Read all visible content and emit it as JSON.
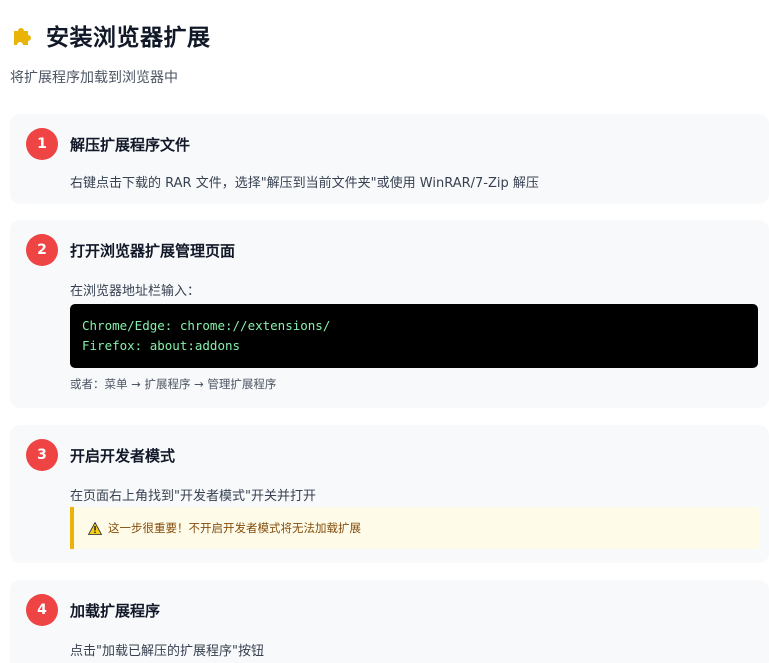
{
  "header": {
    "icon": "puzzle-piece-icon",
    "title": "安装浏览器扩展",
    "subtitle": "将扩展程序加载到浏览器中"
  },
  "colors": {
    "badge": "#ef4444",
    "warning_border": "#eab308",
    "warning_bg": "#fefce8",
    "code_bg": "#000000",
    "code_text": "#86efac",
    "card_bg": "#f8f9fb"
  },
  "steps": [
    {
      "number": "1",
      "title": "解压扩展程序文件",
      "description": "右键点击下载的 RAR 文件，选择\"解压到当前文件夹\"或使用 WinRAR/7-Zip 解压"
    },
    {
      "number": "2",
      "title": "打开浏览器扩展管理页面",
      "description": "在浏览器地址栏输入：",
      "code": [
        "Chrome/Edge: chrome://extensions/",
        "Firefox: about:addons"
      ],
      "note": "或者：菜单 → 扩展程序 → 管理扩展程序"
    },
    {
      "number": "3",
      "title": "开启开发者模式",
      "description": "在页面右上角找到\"开发者模式\"开关并打开",
      "warning": {
        "icon": "warning-triangle-icon",
        "text": "这一步很重要！不开启开发者模式将无法加载扩展"
      }
    },
    {
      "number": "4",
      "title": "加载扩展程序",
      "description": "点击\"加载已解压的扩展程序\"按钮"
    }
  ]
}
